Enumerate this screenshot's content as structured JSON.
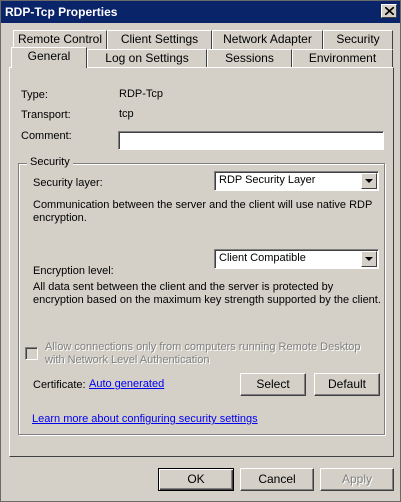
{
  "window": {
    "title": "RDP-Tcp Properties"
  },
  "tabs": {
    "back_row": [
      "Remote Control",
      "Client Settings",
      "Network Adapter",
      "Security"
    ],
    "front_row": [
      "General",
      "Log on Settings",
      "Sessions",
      "Environment"
    ],
    "active": "General"
  },
  "general": {
    "type_label": "Type:",
    "type_value": "RDP-Tcp",
    "transport_label": "Transport:",
    "transport_value": "tcp",
    "comment_label": "Comment:",
    "comment_value": ""
  },
  "security": {
    "group_title": "Security",
    "security_layer_label": "Security layer:",
    "security_layer_value": "RDP Security Layer",
    "security_layer_description": "Communication between the server and the client will use native RDP encryption.",
    "encryption_level_label": "Encryption level:",
    "encryption_level_value": "Client Compatible",
    "encryption_description": "All data sent between the client and the server is protected by encryption based on the maximum key strength supported by the client.",
    "nla_checkbox_label": "Allow connections only from computers running Remote Desktop with Network Level Authentication",
    "nla_checked": false,
    "certificate_label": "Certificate:",
    "certificate_value": "Auto generated",
    "select_button": "Select",
    "default_button": "Default"
  },
  "learn_more_link": "Learn more about configuring security settings",
  "buttons": {
    "ok": "OK",
    "cancel": "Cancel",
    "apply": "Apply"
  },
  "colors": {
    "titlebar": "#0a246a",
    "face": "#d4d0c8",
    "link": "#0000ee"
  },
  "icons": {
    "close": "close-icon",
    "dropdown": "chevron-down-icon"
  }
}
